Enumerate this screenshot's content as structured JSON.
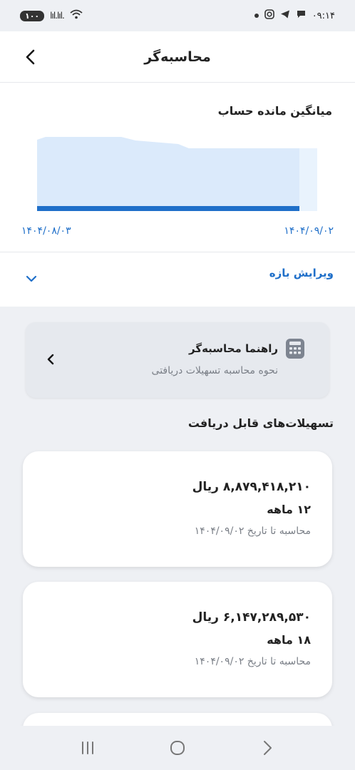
{
  "status_bar": {
    "time": "۰۹:۱۴",
    "battery": "۱۰۰",
    "signal": "lıl.lıl."
  },
  "header": {
    "title": "محاسبه‌گر"
  },
  "chart": {
    "title": "میانگین مانده حساب",
    "start_date": "۱۴۰۴/۰۹/۰۲",
    "end_date": "۱۴۰۴/۰۸/۰۳",
    "area_color": "#dbeafb",
    "line_color": "#1f6fc9"
  },
  "edit_range": {
    "label": "ویرایش بازه"
  },
  "guide": {
    "title": "راهنما محاسبه‌گر",
    "subtitle": "نحوه محاسبه تسهیلات دریافتی"
  },
  "loans_section": {
    "title": "تسهیلات‌های قابل دریافت",
    "items": [
      {
        "amount": "۸,۸۷۹,۴۱۸,۲۱۰ ریال",
        "term": "۱۲ ماهه",
        "date_note": "محاسبه تا تاریخ ۱۴۰۴/۰۹/۰۲"
      },
      {
        "amount": "۶,۱۴۷,۲۸۹,۵۳۰ ریال",
        "term": "۱۸ ماهه",
        "date_note": "محاسبه تا تاریخ ۱۴۰۴/۰۹/۰۲"
      }
    ]
  }
}
